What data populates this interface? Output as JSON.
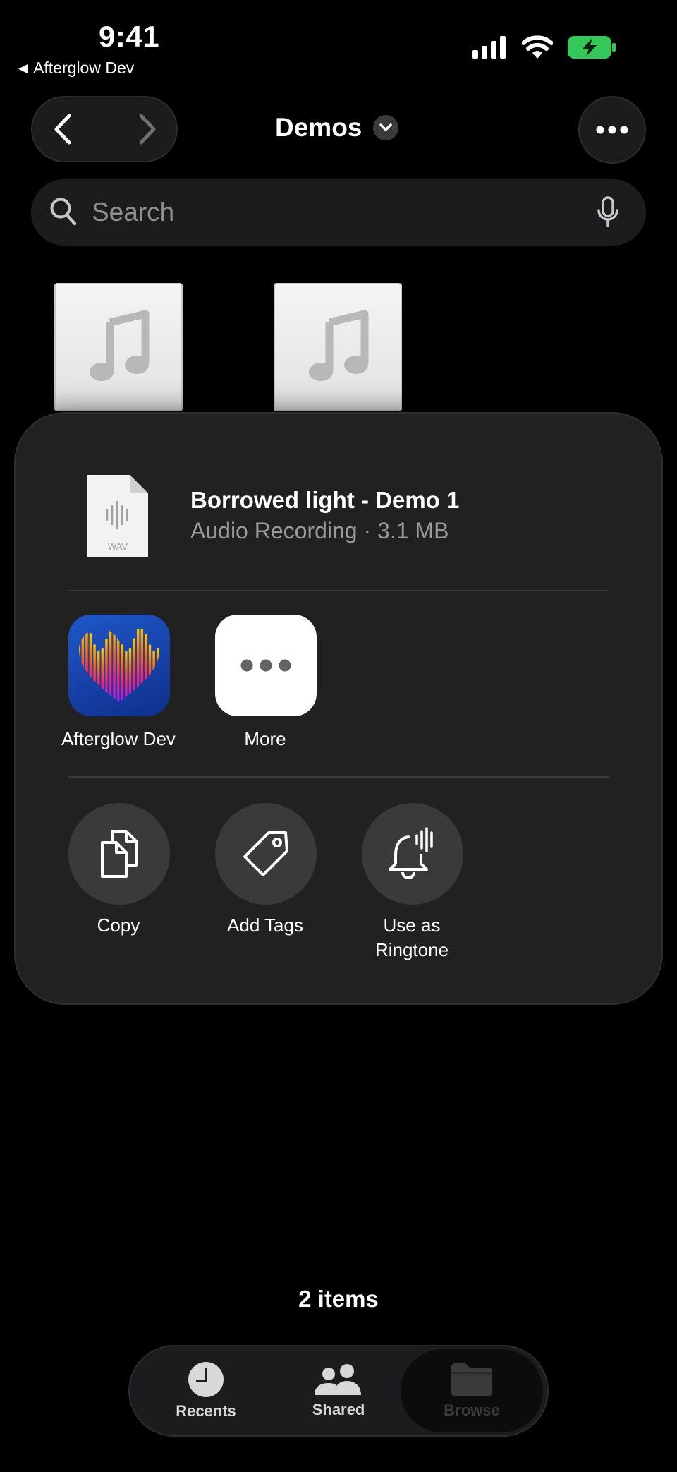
{
  "status_bar": {
    "time": "9:41",
    "back_app": "Afterglow Dev",
    "battery_color": "#34c759"
  },
  "nav": {
    "title": "Demos"
  },
  "search": {
    "placeholder": "Search"
  },
  "files": [
    {
      "icon": "music-note-icon"
    },
    {
      "icon": "music-note-icon"
    }
  ],
  "share_sheet": {
    "file_name": "Borrowed light - Demo 1",
    "file_meta": "Audio Recording · 3.1 MB",
    "file_type": "WAV",
    "apps": [
      {
        "label": "Afterglow Dev",
        "icon": "afterglow-heart-icon"
      },
      {
        "label": "More",
        "icon": "ellipsis-icon"
      }
    ],
    "actions": [
      {
        "label": "Copy",
        "icon": "copy-icon"
      },
      {
        "label": "Add Tags",
        "icon": "tag-icon"
      },
      {
        "label": "Use as\nRingtone",
        "icon": "bell-icon"
      }
    ]
  },
  "footer": {
    "item_count": "2 items"
  },
  "tabs": [
    {
      "label": "Recents",
      "icon": "clock-icon"
    },
    {
      "label": "Shared",
      "icon": "people-icon"
    },
    {
      "label": "Browse",
      "icon": "folder-icon",
      "selected": true
    }
  ]
}
